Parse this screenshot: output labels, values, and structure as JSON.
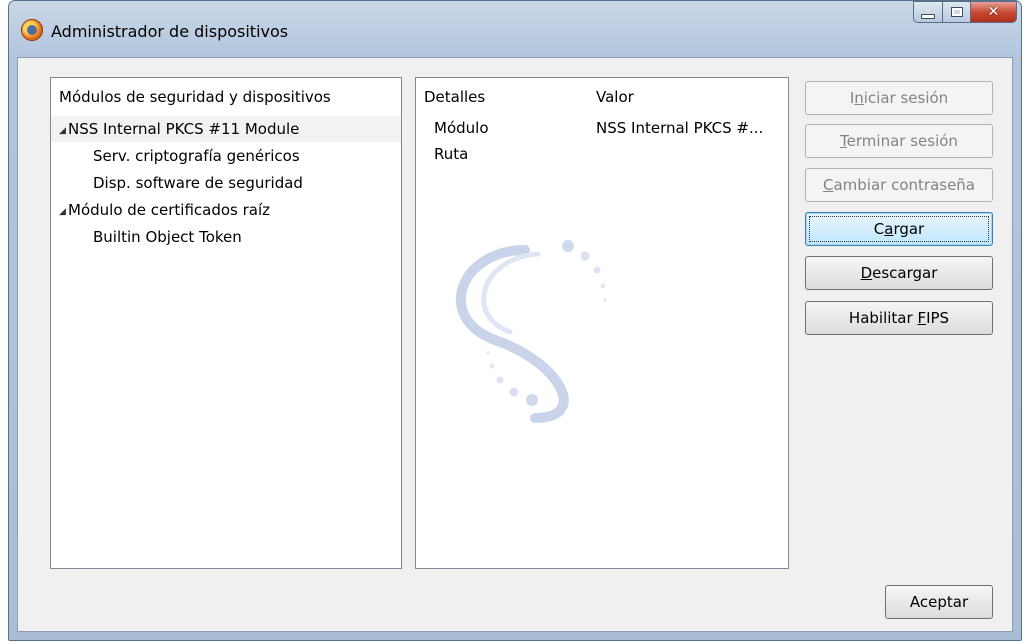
{
  "window": {
    "title": "Administrador de dispositivos"
  },
  "modules_panel": {
    "header": "Módulos de seguridad y dispositivos",
    "items": [
      {
        "label": "NSS Internal PKCS #11 Module",
        "level": 0,
        "expanded": true,
        "selected": true
      },
      {
        "label": "Serv. criptografía genéricos",
        "level": 1
      },
      {
        "label": "Disp. software de seguridad",
        "level": 1
      },
      {
        "label": "Módulo de certificados raíz",
        "level": 0,
        "expanded": true
      },
      {
        "label": "Builtin Object Token",
        "level": 1
      }
    ]
  },
  "details_panel": {
    "col_details": "Detalles",
    "col_value": "Valor",
    "rows": [
      {
        "detail": "Módulo",
        "value": "NSS Internal PKCS #..."
      },
      {
        "detail": "Ruta",
        "value": ""
      }
    ]
  },
  "buttons": {
    "login": {
      "label": "Iniciar sesión",
      "accesskey": "n",
      "enabled": false
    },
    "logout": {
      "label": "Terminar sesión",
      "accesskey": "T",
      "enabled": false
    },
    "change_password": {
      "label": "Cambiar contraseña",
      "accesskey": "C",
      "enabled": false
    },
    "load": {
      "label": "Cargar",
      "accesskey": "a",
      "enabled": true,
      "focused": true
    },
    "unload": {
      "label": "Descargar",
      "accesskey": "D",
      "enabled": true
    },
    "fips": {
      "label": "Habilitar FIPS",
      "accesskey": "F",
      "enabled": true
    },
    "ok": {
      "label": "Aceptar",
      "enabled": true
    }
  },
  "colors": {
    "frame": "#b3c6de",
    "dialog_bg": "#f0f0f0",
    "close_button": "#c6452e",
    "selection_row": "#f2f2f2",
    "disabled_text": "#838383"
  },
  "icons": {
    "app": "firefox-icon",
    "watermark": "nss-logo-icon"
  }
}
